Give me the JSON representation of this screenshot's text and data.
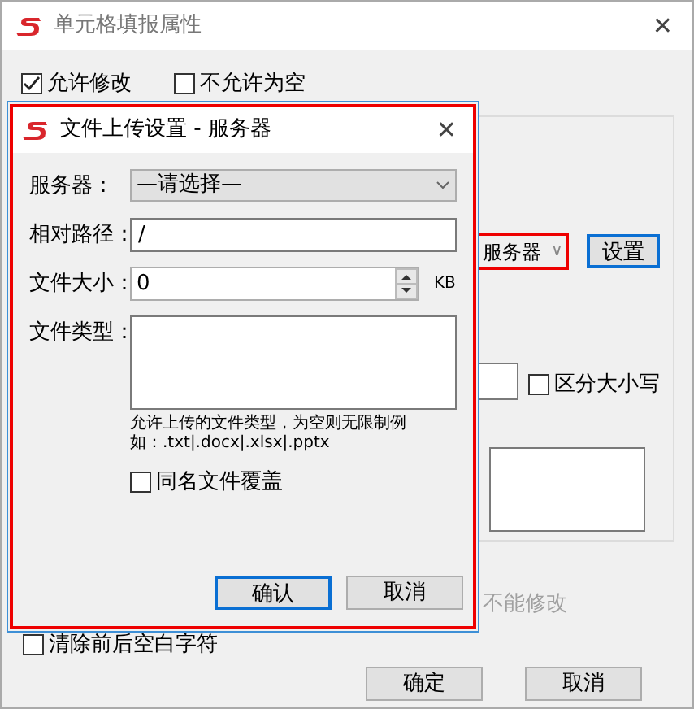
{
  "window": {
    "title": "单元格填报属性",
    "close": "✕"
  },
  "options": [
    {
      "label": "允许修改",
      "checked": true
    },
    {
      "label": "不允许为空",
      "checked": false
    }
  ],
  "back_panel": {
    "dropdown": {
      "value": "服务器",
      "caret": "∨"
    },
    "settings_button": "设置",
    "case_option": {
      "label": "区分大小写",
      "checked": false
    },
    "covered_option": {
      "label": "不能修改",
      "disabled": true
    }
  },
  "trim_option": {
    "label": "清除前后空白字符",
    "checked": false
  },
  "buttons": [
    "确定",
    "取消"
  ],
  "dialog": {
    "title": "文件上传设置 - 服务器",
    "close": "✕",
    "fields": [
      {
        "kind": "select",
        "label": "服务器：",
        "value": "—请选择—"
      },
      {
        "kind": "text",
        "label": "相对路径：",
        "value": "/"
      },
      {
        "kind": "spin",
        "label": "文件大小：",
        "value": "0",
        "unit": "KB"
      },
      {
        "kind": "textarea",
        "label": "文件类型：",
        "hint": "允许上传的文件类型，为空则无限制例如：.txt|.docx|.xlsx|.pptx"
      }
    ],
    "overwrite_option": {
      "label": "同名文件覆盖",
      "checked": false
    },
    "buttons": [
      {
        "label": "确认",
        "selected": true
      },
      {
        "label": "取消",
        "selected": false
      }
    ]
  }
}
